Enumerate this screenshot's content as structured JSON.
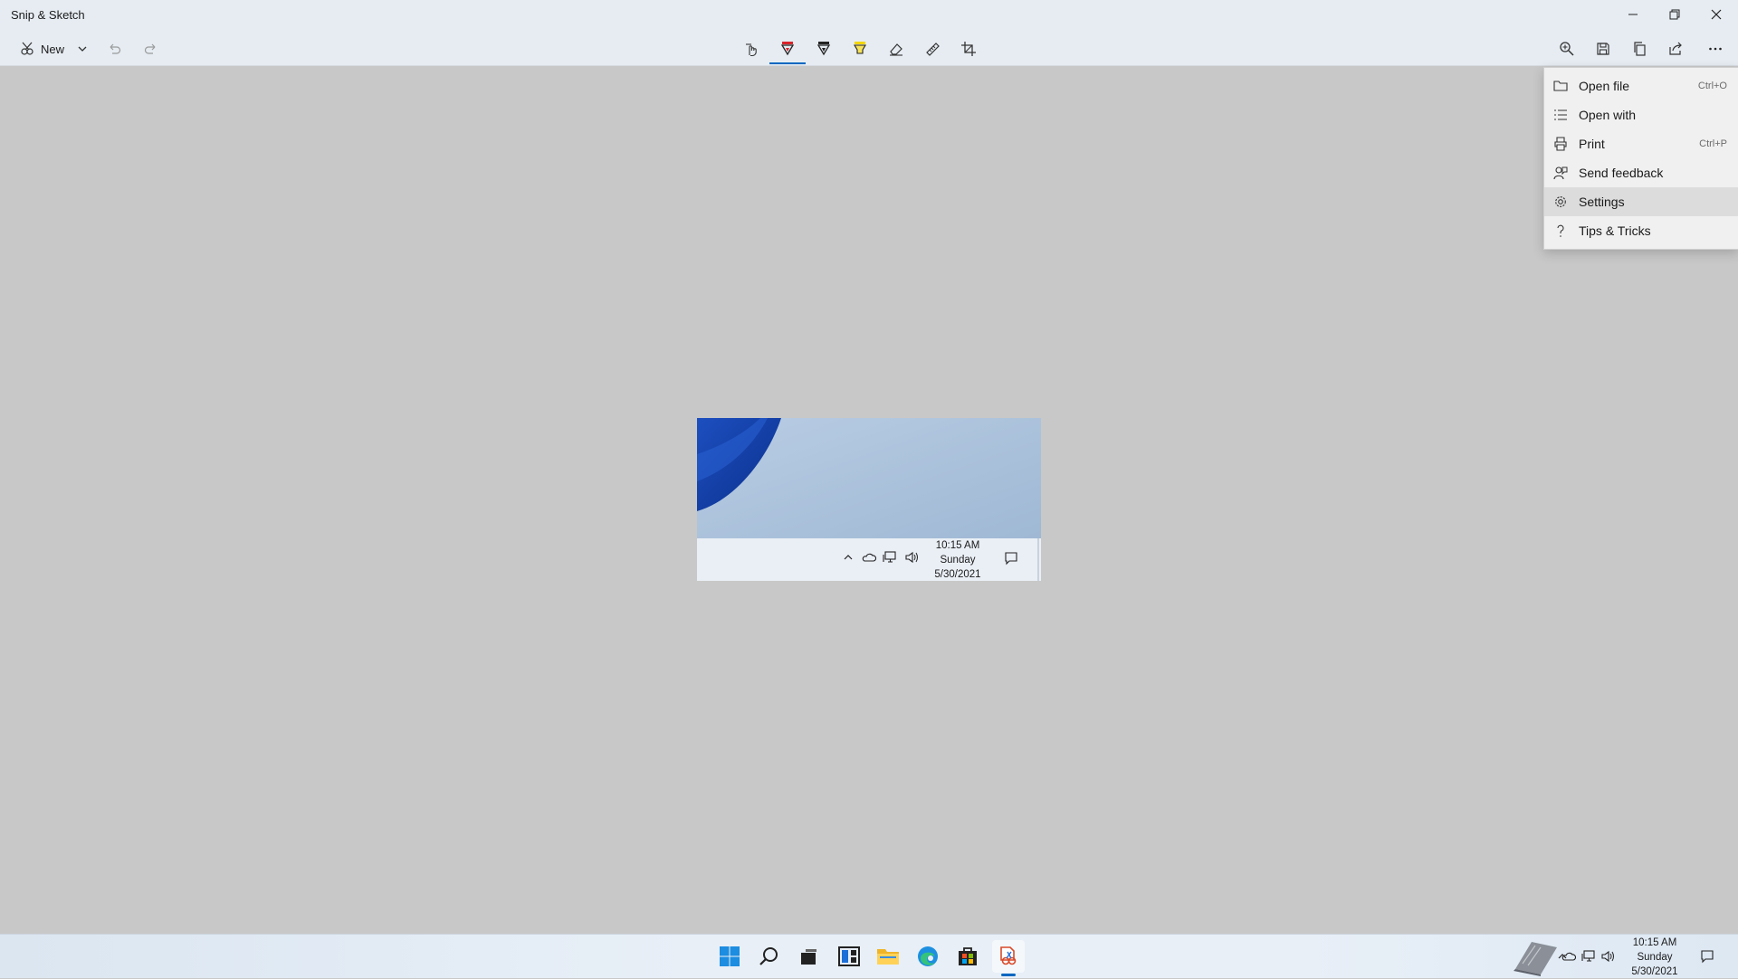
{
  "window": {
    "title": "Snip & Sketch"
  },
  "toolbar": {
    "new_label": "New"
  },
  "menu": {
    "items": [
      {
        "label": "Open file",
        "shortcut": "Ctrl+O",
        "icon": "folder-icon"
      },
      {
        "label": "Open with",
        "shortcut": "",
        "icon": "list-icon"
      },
      {
        "label": "Print",
        "shortcut": "Ctrl+P",
        "icon": "printer-icon"
      },
      {
        "label": "Send feedback",
        "shortcut": "",
        "icon": "feedback-icon"
      },
      {
        "label": "Settings",
        "shortcut": "",
        "icon": "gear-icon",
        "highlighted": true
      },
      {
        "label": "Tips & Tricks",
        "shortcut": "",
        "icon": "question-icon"
      }
    ]
  },
  "snip_image": {
    "clock_time": "10:15 AM",
    "clock_day": "Sunday",
    "clock_date": "5/30/2021"
  },
  "taskbar": {
    "clock_time": "10:15 AM",
    "clock_day": "Sunday",
    "clock_date": "5/30/2021",
    "apps": [
      "start-icon",
      "search-icon",
      "task-view-icon",
      "widgets-icon",
      "file-explorer-icon",
      "edge-icon",
      "store-icon",
      "snip-sketch-icon"
    ]
  },
  "colors": {
    "accent": "#0067c0",
    "canvas_bg": "#c8c8c8",
    "titlebar_bg": "#e6ecf2",
    "menu_bg": "#f0f0f0"
  }
}
